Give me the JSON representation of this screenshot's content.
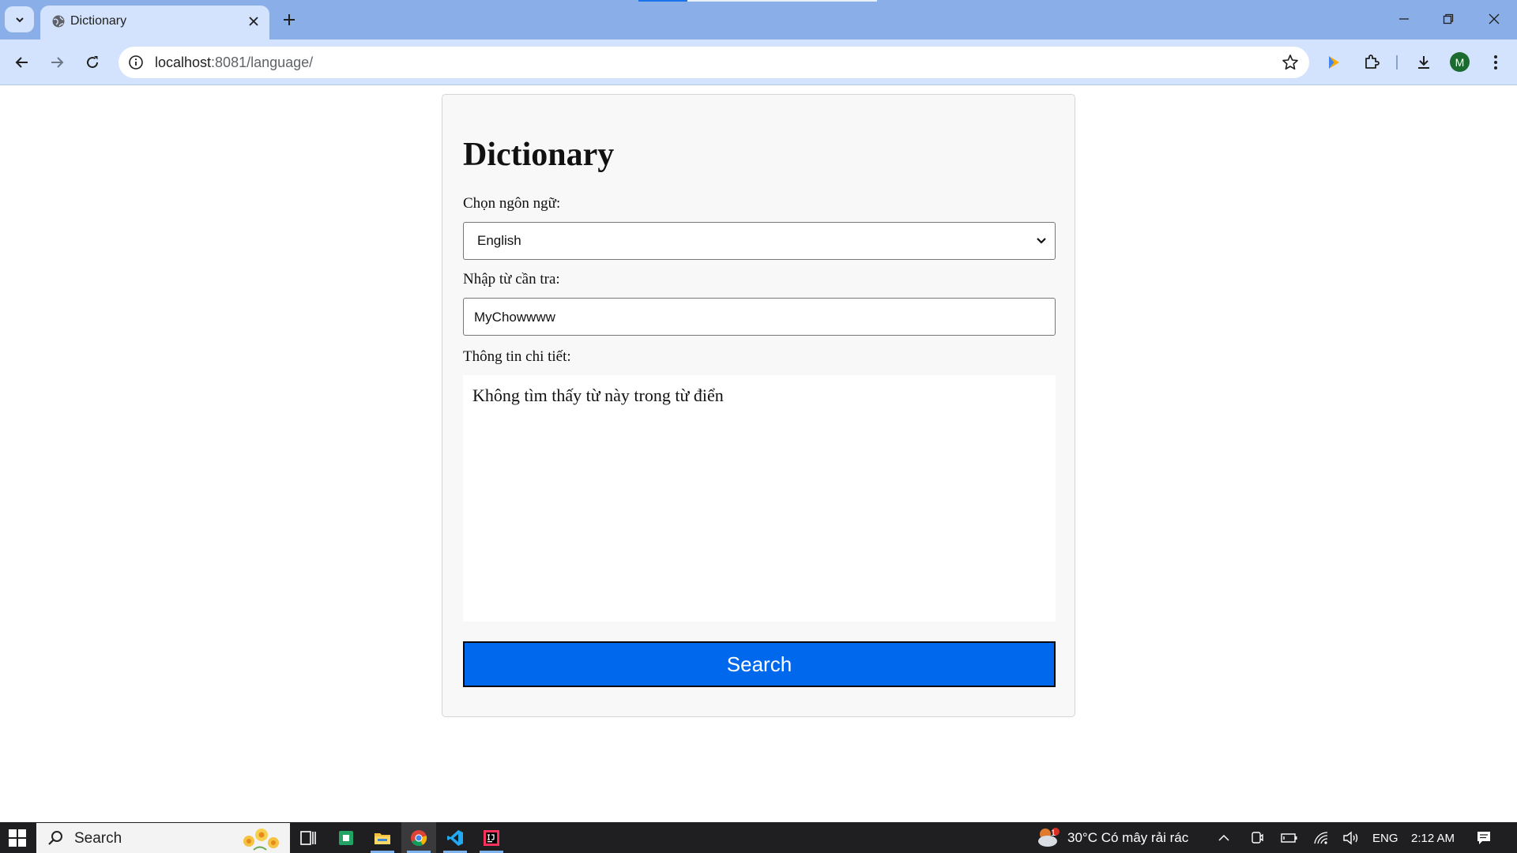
{
  "browser": {
    "tab": {
      "title": "Dictionary"
    },
    "address": {
      "host": "localhost",
      "rest": ":8081/language/"
    }
  },
  "page": {
    "title": "Dictionary",
    "language_label": "Chọn ngôn ngữ:",
    "language_selected": "English",
    "word_label": "Nhập từ cần tra:",
    "word_value": "MyChowwww",
    "detail_label": "Thông tin chi tiết:",
    "detail_text": "Không tìm thấy từ này trong từ điển",
    "search_button": "Search"
  },
  "taskbar": {
    "search_placeholder": "Search",
    "weather": "30°C  Có mây rải rác",
    "weather_badge": "1",
    "language": "ENG",
    "time": "2:12 AM"
  },
  "colors": {
    "tabstrip": "#8aaee8",
    "toolbar": "#d3e3fd",
    "primary_button": "#0068ed",
    "taskbar": "#1f1f21"
  }
}
